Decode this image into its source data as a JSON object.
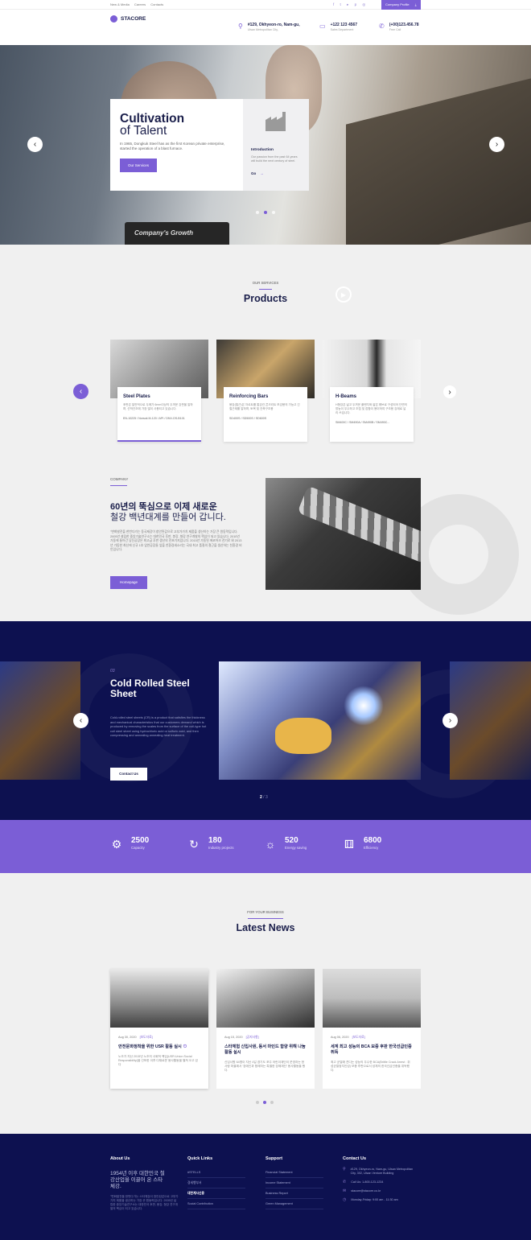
{
  "topbar": {
    "links": [
      "New & Media",
      "Careers",
      "Contacts"
    ],
    "social_icons": [
      "facebook-icon",
      "twitter-icon",
      "youtube-icon",
      "pinterest-icon",
      "instagram-icon"
    ],
    "company_profile": "Company Profile"
  },
  "header": {
    "logo_text": "STACORE",
    "address_title": "#129, Okhyeon-ro, Nam-gu,",
    "address_sub": "Ulsan Metropolitan City,",
    "phone_title": "+122 123 4567",
    "phone_sub": "Sales Department",
    "fax_title": "(+00)123.456.78",
    "fax_sub": "Free Call"
  },
  "hero": {
    "title_bold": "Cultivation",
    "title_light": "of Talent",
    "description": "In 1965, Dongkuk Steel has as the first Korean private enterprise, started the operation of a blast furnace.",
    "button": "Our Services",
    "side_title": "Introduction",
    "side_desc": "Our passion from the past 64 years will build the next century of steel.",
    "side_link": "Go",
    "laptop_text": "Company's Growth",
    "slide_current": 2,
    "slide_count": 3
  },
  "products": {
    "subtitle": "OUR SERVICES",
    "title": "Products",
    "items": [
      {
        "name": "Steel Plates",
        "desc": "후판은 일반적으로 두께가 6mm이상의 두꺼운 강판을 말하며, 선박건조에 가장 많이 사용되고 있습니다.",
        "spec": "EN-10225 / Norsok M-120 / API / DNV-OS-B101"
      },
      {
        "name": "Reinforcing Bars",
        "desc": "봉강(철근)은 자르트를 통강건 콘크리트 보강용의 가능고 긴 철근제를 말하며, 토목 및 건축구조용",
        "spec": "SD400S / SD500S / SD600S"
      },
      {
        "name": "H-Beams",
        "desc": "H형강은 넓고 두꺼운 플랜지와 얇은 웨브로 구성되어 단면의 방능이 우수하고 조립 및 접합이 용이하여 구조용 강재로 널리 쓰입니다.",
        "spec": "SM400C / SM490A / SM490B / SM490C..."
      }
    ]
  },
  "company": {
    "subtitle": "COMPANY",
    "heading_bold": "60년의 뚝심으로 이제 새로운",
    "heading_light": "철강 백년대계를 만들어 갑니다.",
    "description": "\"변화발전을 한번다가는 동국제강이 창안된감으로 고부가가치 제품을 생산하는 가장 큰 원동력입니다. 2005년 설립한 중앙기술연구소는 대한민국 후판, 봉강, 형강 연구개발의 핵심이 되고 있습니다. 2010년 가동에 들어간 당진공장은 최고급 후판 생산의 전초기지입니다. 2015년 가동된 에코어크 전기로 와 2013년 가동한 최신에 신규 1호 압연공장들 앞을 친환경새소리는 국내 최고 품질의 철근을 생산하는 친환경 비인입니다.",
    "button": "Homepage"
  },
  "feature": {
    "number": "03",
    "title": "Cold Rolled Steel Sheet",
    "description": "Cold-rolled steel sheets (CR) is a product that satisfies the thickness and mechanical characteristics that our customers demand which is produced by removing the scales from the surface of the coil-type hot coil steel sheet using hydrochloric acid or sulfuric acid, and then compressing and annealing annealing heat treatment.",
    "button": "Contact Us",
    "page_current": "2",
    "page_total": "3"
  },
  "stats": [
    {
      "icon": "gear-icon",
      "value": "2500",
      "label": "Capacity"
    },
    {
      "icon": "refresh-icon",
      "value": "180",
      "label": "Industry projects"
    },
    {
      "icon": "bulb-icon",
      "value": "520",
      "label": "Energy saving"
    },
    {
      "icon": "dice-icon",
      "value": "6800",
      "label": "Efficiency"
    }
  ],
  "news": {
    "subtitle": "FOR YOUR BUSINESS",
    "title": "Latest News",
    "items": [
      {
        "date": "Aug 30, 2020",
        "tag": "[보도자료]",
        "title": "안전문화정착을 위한 USR 활동 실시",
        "desc": "노조가 지난 2015년 노조의 사회적 책임(USR:Union Social Responsibility)을 선포한 이후 다채로운 봉사활동을 펼쳐 오고 있다"
      },
      {
        "date": "Aug 15, 2020",
        "tag": "[공지사항]",
        "title": "스타체험 신입사원, 동서 마인드 함양 위해 나눔활동 실시",
        "desc": "신입사원 64명이 지난 4일 경기도 포주 어린이재단이 운영하는 한사랑 마을에서 '장애인과 함께하는 특별한 장애재단' 봉사활동을 했다."
      },
      {
        "date": "Aug 06, 2020",
        "tag": "[보도자료]",
        "title": "세계 최고 성능의 BCA 보증 후판 한국선급인증 취득",
        "desc": "최고 균열에 견디는 성능의 우수한 BCA(Brittle Crack Arrest : 취성균열정지인성) 보증 후판으로서 성체의 한국선급인증을 취득했다."
      }
    ]
  },
  "footer": {
    "about_title": "About Us",
    "about_heading": "1954년 이후 대한민국 철강산업을 이끌어 온 스타체강.",
    "about_desc": "\"변화발전을 한번다가는 스타체강이 창안된감으로 고부가가치 제품을 생산하는 가장 큰 원동력입니다. 2005년 설립한 중앙기술연구소는 대한민국 후판, 봉강, 형강 연구개발의 핵심이 되고 있습니다.",
    "quick_title": "Quick Links",
    "quick_links": [
      "#STELLS",
      "경세행부서",
      "대한계사신용",
      "Social Contribution"
    ],
    "support_title": "Support",
    "support_links": [
      "Financial Statement",
      "Income Statement",
      "Business Report",
      "Green Management"
    ],
    "contact_title": "Contact Us",
    "contacts": [
      {
        "icon": "location-icon",
        "text": "#129, Okhyeon-ro, Nam-gu, Ulsan Metropolitan City, 302, Ulsan Venture Building"
      },
      {
        "icon": "phone-icon",
        "text": "Call Us: 1-800-123-1234"
      },
      {
        "icon": "mail-icon",
        "text": "stacore@stacore.co.kr"
      },
      {
        "icon": "clock-icon",
        "text": "Monday-Friday: 9:00 am - 11:30 am"
      }
    ]
  }
}
